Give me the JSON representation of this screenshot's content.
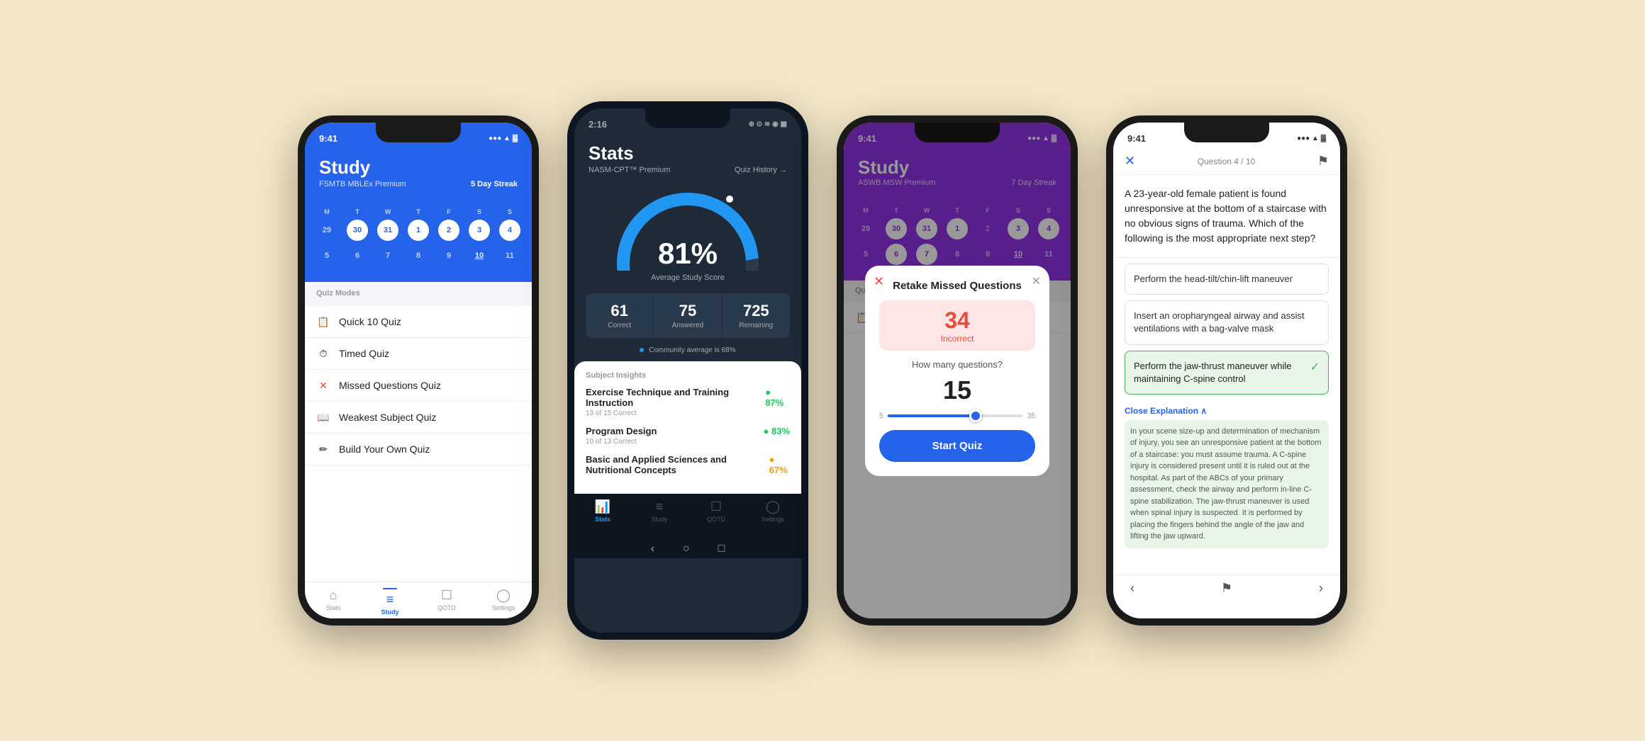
{
  "page": {
    "background": "#f5e8c8"
  },
  "phone1": {
    "status": {
      "time": "9:41",
      "signal": "●●●",
      "wifi": "▲",
      "battery": "▓"
    },
    "header": {
      "title": "Study",
      "subtitle": "FSMTB MBLEx Premium",
      "streak": "5 Day Streak"
    },
    "calendar": {
      "day_labels": [
        "M",
        "T",
        "W",
        "T",
        "F",
        "S",
        "S"
      ],
      "row1": [
        "29",
        "30",
        "31",
        "1",
        "2",
        "3",
        "4"
      ],
      "row2": [
        "5",
        "6",
        "7",
        "8",
        "9",
        "10",
        "11"
      ]
    },
    "quiz_modes_label": "Quiz Modes",
    "quiz_items": [
      {
        "icon": "📋",
        "label": "Quick 10 Quiz"
      },
      {
        "icon": "⏱",
        "label": "Timed Quiz"
      },
      {
        "icon": "✕",
        "label": "Missed Questions Quiz"
      },
      {
        "icon": "📖",
        "label": "Weakest Subject Quiz"
      },
      {
        "icon": "✏",
        "label": "Build Your Own Quiz"
      }
    ],
    "nav": [
      {
        "icon": "⌂",
        "label": "Stats",
        "active": false
      },
      {
        "icon": "≡",
        "label": "Study",
        "active": true
      },
      {
        "icon": "☐",
        "label": "QOTD",
        "active": false
      },
      {
        "icon": "◯",
        "label": "Settings",
        "active": false
      }
    ]
  },
  "phone2": {
    "status": {
      "time": "2:16",
      "icons": "⊕ ⊙ ◫ ≋ ≈ ▦ ⋈ ◉ ◈"
    },
    "header": {
      "title": "Stats",
      "subtitle": "NASM-CPT™ Premium",
      "quiz_history": "Quiz History →"
    },
    "gauge": {
      "percent": "81%",
      "label": "Average Study Score"
    },
    "stats": [
      {
        "num": "61",
        "label": "Correct"
      },
      {
        "num": "75",
        "label": "Answered"
      },
      {
        "num": "725",
        "label": "Remaining"
      }
    ],
    "community_avg": "Community average is 68%",
    "subject_insights_label": "Subject Insights",
    "subjects": [
      {
        "name": "Exercise Technique and Training Instruction",
        "sub": "13 of 15 Correct",
        "pct": "87%",
        "color": "green"
      },
      {
        "name": "Program Design",
        "sub": "10 of 13 Correct",
        "pct": "83%",
        "color": "green"
      },
      {
        "name": "Basic and Applied Sciences and Nutritional Concepts",
        "sub": "",
        "pct": "67%",
        "color": "yellow"
      }
    ],
    "nav": [
      {
        "icon": "📊",
        "label": "Stats",
        "active": true
      },
      {
        "icon": "📚",
        "label": "Study",
        "active": false
      },
      {
        "icon": "☐",
        "label": "QOTD",
        "active": false
      },
      {
        "icon": "◯",
        "label": "Settings",
        "active": false
      }
    ]
  },
  "phone3": {
    "status": {
      "time": "9:41"
    },
    "header": {
      "title": "Study",
      "subtitle": "ASWB MSW Premium",
      "streak": "7 Day Streak"
    },
    "modal": {
      "title": "Retake Missed Questions",
      "incorrect_num": "34",
      "incorrect_label": "Incorrect",
      "how_many": "How many questions?",
      "count": "15",
      "slider_min": "5",
      "slider_max": "35",
      "start_btn": "Start Quiz"
    }
  },
  "phone4": {
    "status": {
      "time": "9:41"
    },
    "question_num": "Question 4 / 10",
    "question": "A 23-year-old female patient is found unresponsive at the bottom of a staircase with no obvious signs of trauma. Which of the following is the most appropriate next step?",
    "answers": [
      {
        "text": "Perform the head-tilt/chin-lift maneuver",
        "correct": false
      },
      {
        "text": "Insert an oropharyngeal airway and assist ventilations with a bag-valve mask",
        "correct": false
      },
      {
        "text": "Perform the jaw-thrust maneuver while maintaining C-spine control",
        "correct": true
      }
    ],
    "close_explanation": "Close Explanation ∧",
    "explanation": "In your scene size-up and determination of mechanism of injury, you see an unresponsive patient at the bottom of a staircase: you must assume trauma. A C-spine injury is considered present until it is ruled out at the hospital. As part of the ABCs of your primary assessment, check the airway and perform in-line C-spine stabilization. The jaw-thrust maneuver is used when spinal injury is suspected. It is performed by placing the fingers behind the angle of the jaw and lifting the jaw upward."
  }
}
